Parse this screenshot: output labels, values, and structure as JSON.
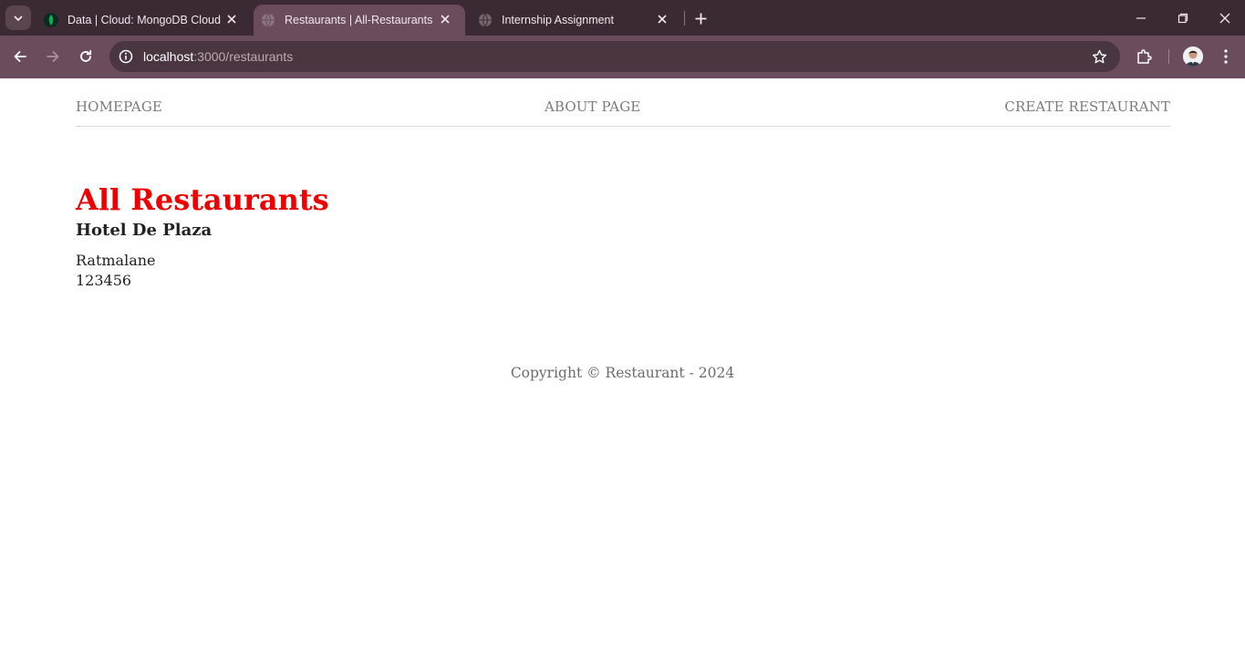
{
  "browser": {
    "tabs": [
      {
        "title": "Data | Cloud: MongoDB Cloud",
        "icon": "mongodb-leaf-icon",
        "active": false
      },
      {
        "title": "Restaurants | All-Restaurants",
        "icon": "globe-icon",
        "active": true
      },
      {
        "title": "Internship Assignment",
        "icon": "globe-icon",
        "active": false
      }
    ],
    "address_bar": {
      "host": "localhost",
      "path": ":3000/restaurants"
    },
    "colors": {
      "tabstrip": "#3b2a33",
      "toolbar": "#6b4c5c",
      "omnibox": "#4a3641"
    }
  },
  "page": {
    "nav": {
      "home": "HOMEPAGE",
      "about": "ABOUT PAGE",
      "create": "CREATE RESTAURANT"
    },
    "heading": "All Restaurants",
    "heading_color": "#ee0000",
    "restaurants": [
      {
        "name": "Hotel De Plaza",
        "address": "Ratmalane",
        "phone": "123456"
      }
    ],
    "footer": "Copyright © Restaurant - 2024"
  }
}
